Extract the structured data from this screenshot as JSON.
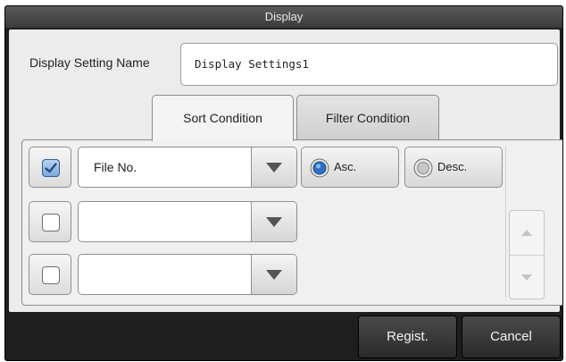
{
  "window": {
    "title": "Display"
  },
  "setting_name": {
    "label": "Display Setting Name",
    "value": "Display Settings1"
  },
  "tabs": [
    {
      "label": "Sort Condition",
      "active": true
    },
    {
      "label": "Filter Condition",
      "active": false
    }
  ],
  "sort_rows": [
    {
      "checked": true,
      "field": "File No."
    },
    {
      "checked": false,
      "field": ""
    },
    {
      "checked": false,
      "field": ""
    }
  ],
  "order": {
    "asc_label": "Asc.",
    "desc_label": "Desc.",
    "selected": "Asc."
  },
  "footer": {
    "regist_label": "Regist.",
    "cancel_label": "Cancel"
  },
  "colors": {
    "accent": "#2f6fc4",
    "dialog_bg": "#1e1e1e",
    "panel_bg": "#ececec"
  },
  "icons": [
    "check-icon",
    "dropdown-arrow-icon",
    "radio-selected-icon",
    "radio-unselected-icon",
    "scroll-up-icon",
    "scroll-down-icon"
  ]
}
